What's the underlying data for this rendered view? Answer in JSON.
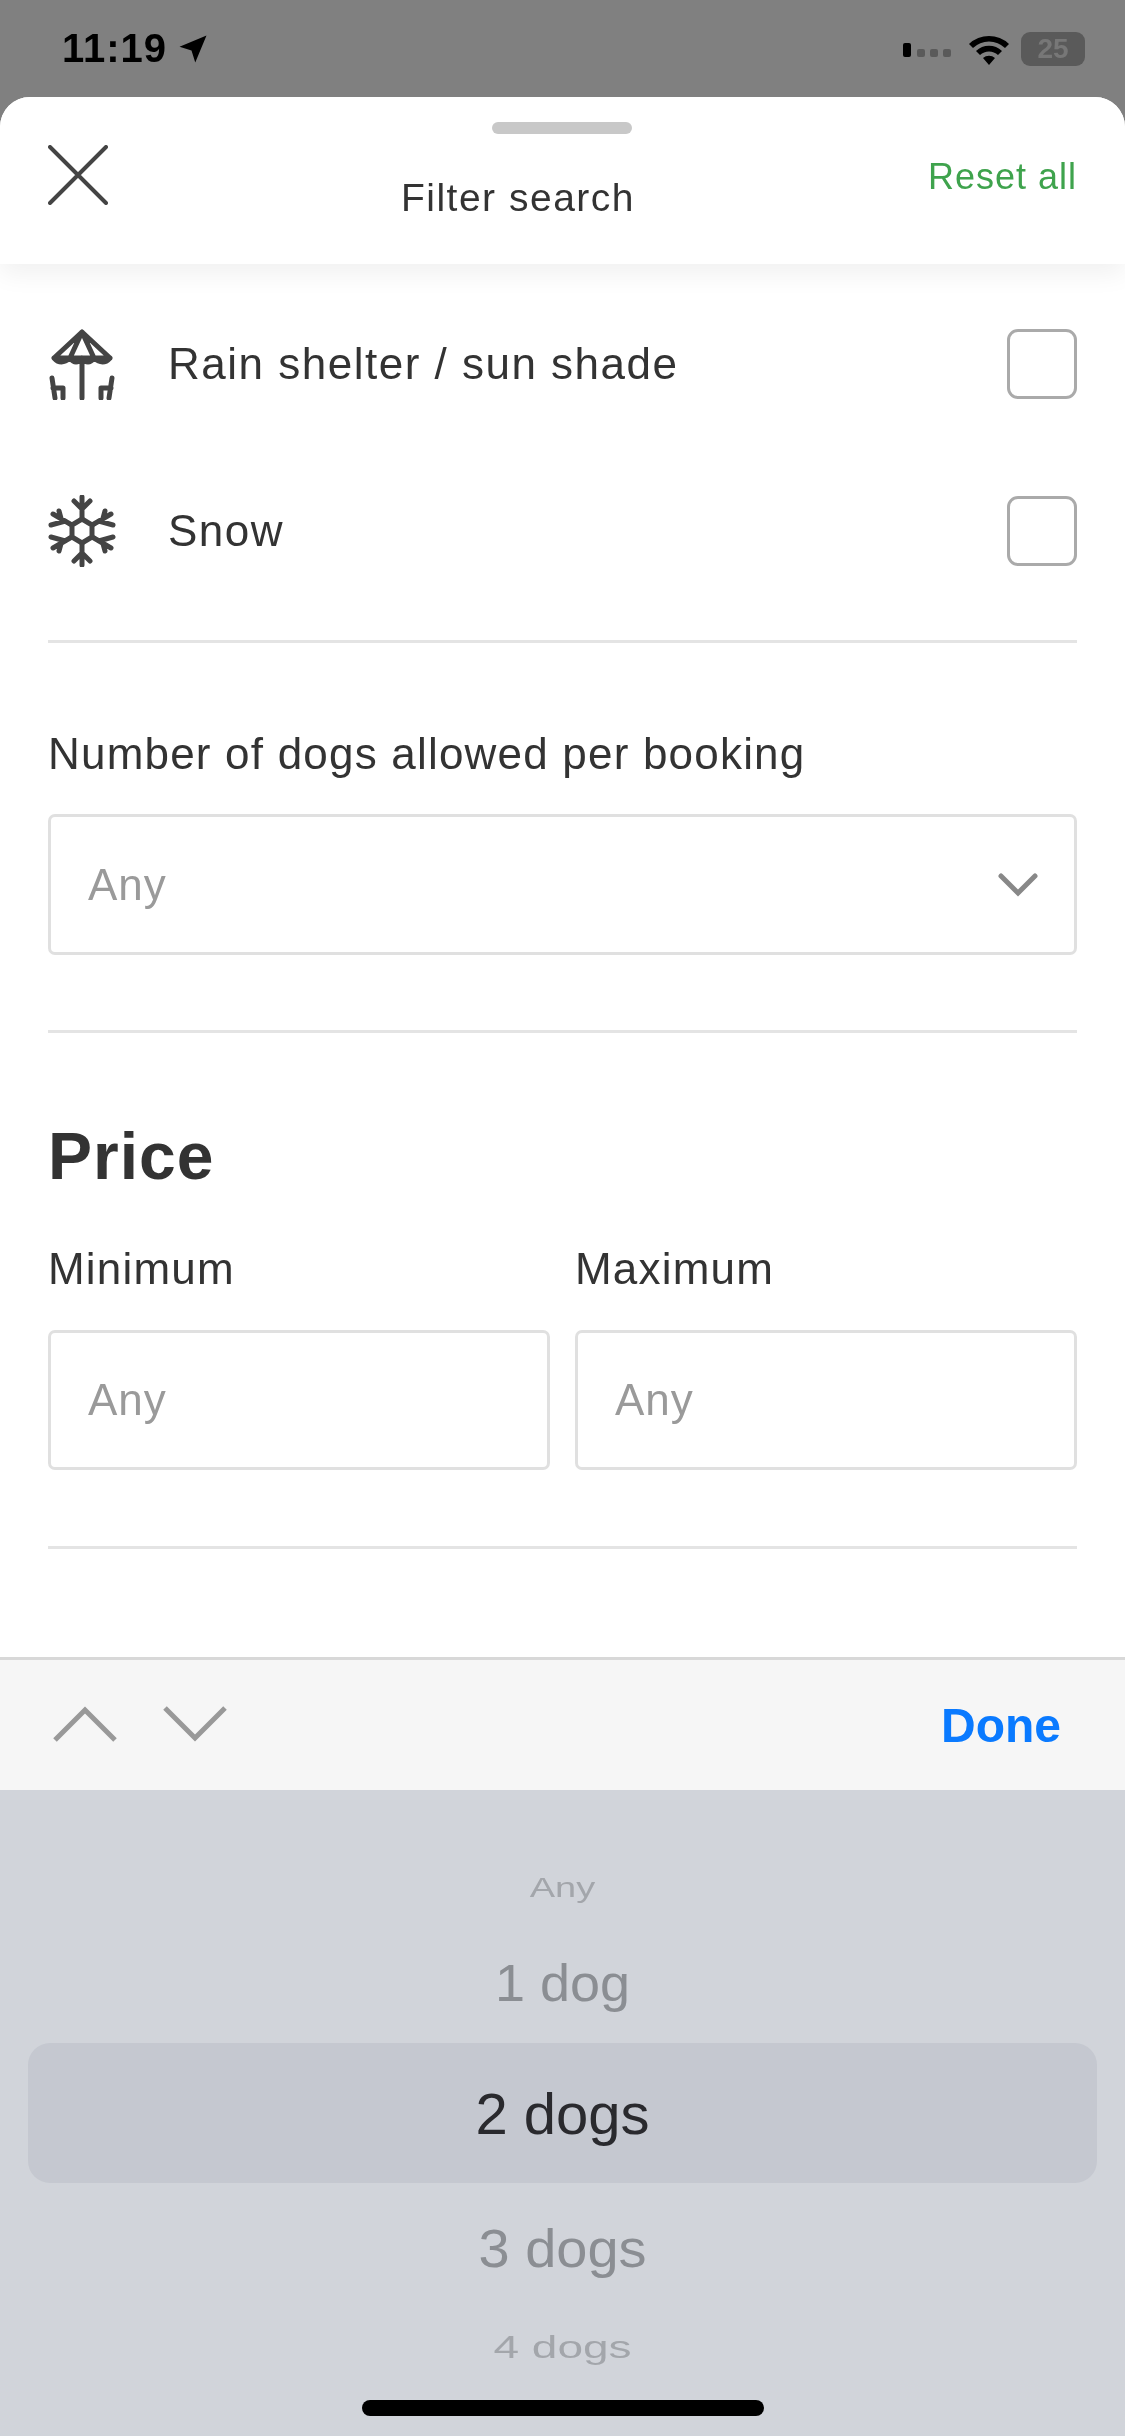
{
  "status_bar": {
    "time": "11:19",
    "battery": "25"
  },
  "header": {
    "title": "Filter search",
    "reset": "Reset all"
  },
  "amenities": [
    {
      "kind": "umbrella",
      "label": "Rain shelter / sun shade",
      "checked": false
    },
    {
      "kind": "snow",
      "label": "Snow",
      "checked": false
    }
  ],
  "dogs": {
    "label": "Number of dogs allowed per booking",
    "placeholder": "Any"
  },
  "price": {
    "title": "Price",
    "fields": [
      {
        "label": "Minimum",
        "placeholder": "Any"
      },
      {
        "label": "Maximum",
        "placeholder": "Any"
      }
    ]
  },
  "toolbar": {
    "done": "Done"
  },
  "picker": [
    {
      "label": "Any",
      "selected": false
    },
    {
      "label": "1 dog",
      "selected": false
    },
    {
      "label": "2 dogs",
      "selected": true
    },
    {
      "label": "3 dogs",
      "selected": false
    },
    {
      "label": "4 dogs",
      "selected": false
    }
  ]
}
